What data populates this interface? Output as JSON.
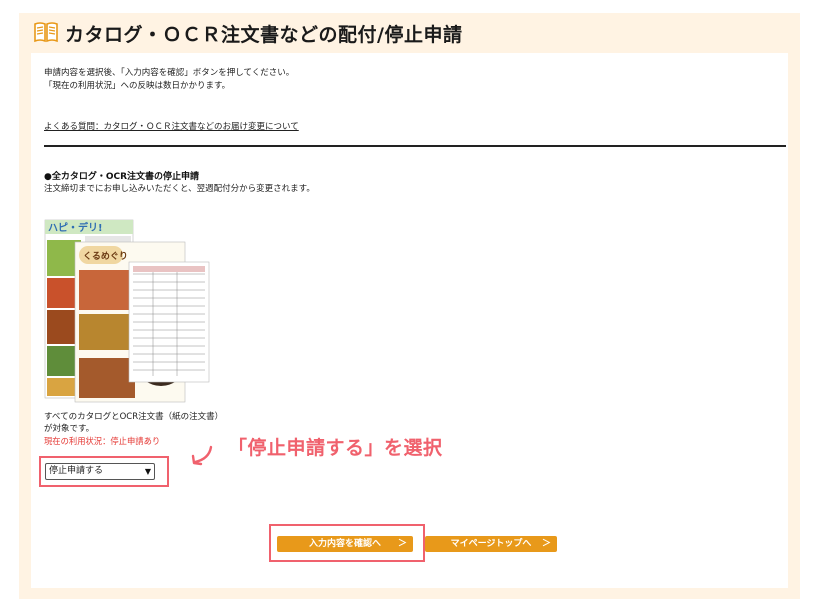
{
  "header": {
    "title": "カタログ・ＯＣＲ注文書などの配付/停止申請",
    "icon": "catalog-book-icon"
  },
  "intro": {
    "line1": "申請内容を選択後、「入力内容を確認」ボタンを押してください。",
    "line2": "「現在の利用状況」への反映は数日かかります。",
    "faq_link": "よくある質問：カタログ・ＯＣＲ注文書などのお届け変更について"
  },
  "section": {
    "title": "●全カタログ・OCR注文書の停止申請",
    "description": "注文締切までにお申し込みいただくと、翌週配付分から変更されます。",
    "catalog_label_1": "ハピ・デリ!",
    "catalog_label_2": "くるめぐり",
    "target_text": "すべてのカタログとOCR注文書（紙の注文書）が対象です。",
    "status_text": "現在の利用状況：停止申請あり",
    "select_value": "停止申請する"
  },
  "annotation": {
    "callout_text": "「停止申請する」を選択",
    "color": "#f0616d"
  },
  "buttons": {
    "confirm_label": "入力内容を確認へ",
    "mypage_label": "マイページトップへ",
    "arrow": "＞",
    "color": "#e8991a"
  },
  "colors": {
    "frame_bg": "#fff3e3",
    "status_red": "#e53935"
  }
}
